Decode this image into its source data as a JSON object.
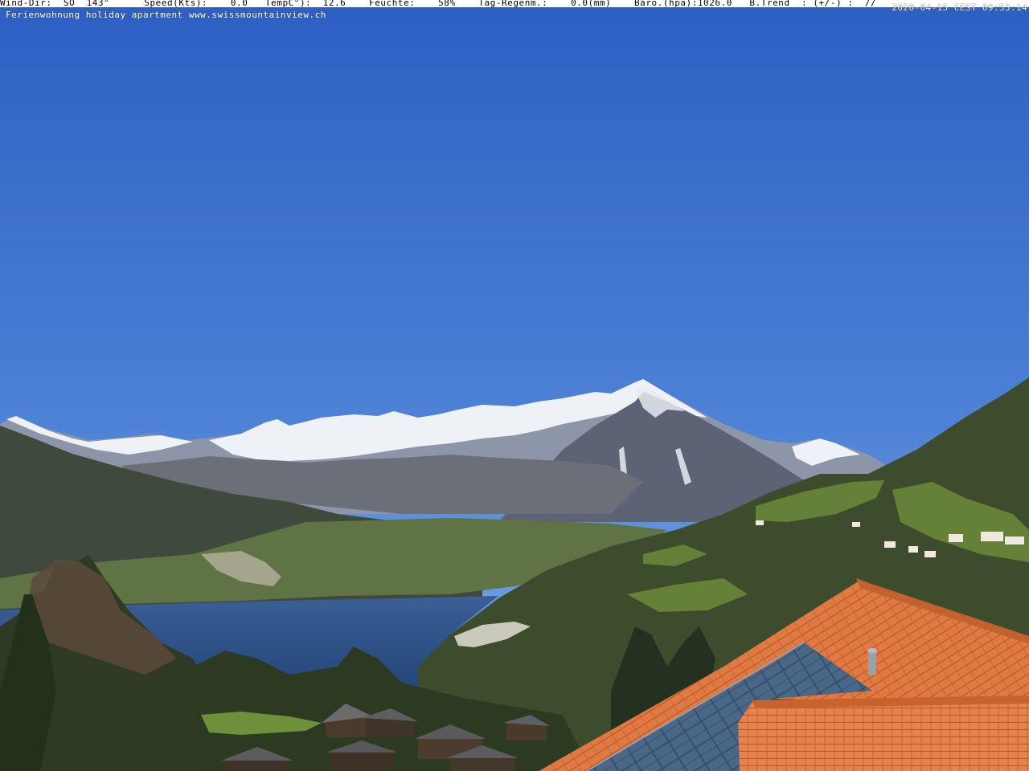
{
  "overlay": {
    "info_line": "Wind-Dir:  SO  143°      Speed(Kts):    0.0   TempC°):  12.6    Feuchte:    58%    Tag-Regenm.:    0.0(mm)    Baro.(hpa):1026.0   B.Trend  : (+/-) :  //",
    "timestamp": "2020-04-15 CEST 09:53:14",
    "subtitle": "Ferienwohnung holiday apartment www.swissmountainview.ch"
  },
  "colors": {
    "sky_top": "#2f62c4",
    "sky_bottom": "#7fa9df",
    "roof": "#e27a45",
    "lake": "#2a4f86"
  }
}
